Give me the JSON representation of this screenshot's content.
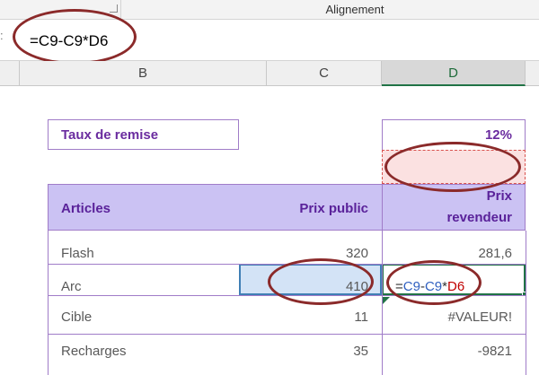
{
  "ribbon": {
    "group_label": "Alignement"
  },
  "formula_bar": {
    "formula": "=C9-C9*D6"
  },
  "columns": {
    "b": "B",
    "c": "C",
    "d": "D"
  },
  "sheet": {
    "discount_label": "Taux de remise",
    "discount_value": "12%",
    "headers": {
      "articles": "Articles",
      "prix_public": "Prix public",
      "prix_revendeur_line1": "Prix",
      "prix_revendeur_line2": "revendeur"
    },
    "rows": [
      {
        "article": "Flash",
        "prix_public": "320",
        "prix_revendeur": "281,6"
      },
      {
        "article": "Arc",
        "prix_public": "410",
        "prix_revendeur": ""
      },
      {
        "article": "Cible",
        "prix_public": "11",
        "prix_revendeur": "#VALEUR!"
      },
      {
        "article": "Recharges",
        "prix_public": "35",
        "prix_revendeur": "-9821"
      }
    ],
    "editing_formula": {
      "eq": "=",
      "ref1": "C9",
      "minus": "-",
      "ref2": "C9",
      "times": "*",
      "ref3": "D6"
    }
  },
  "colors": {
    "accent_purple": "#6a2c9f",
    "header_fill": "#cbc2f3",
    "excel_green": "#217346",
    "annotation": "#8b2a2a"
  }
}
